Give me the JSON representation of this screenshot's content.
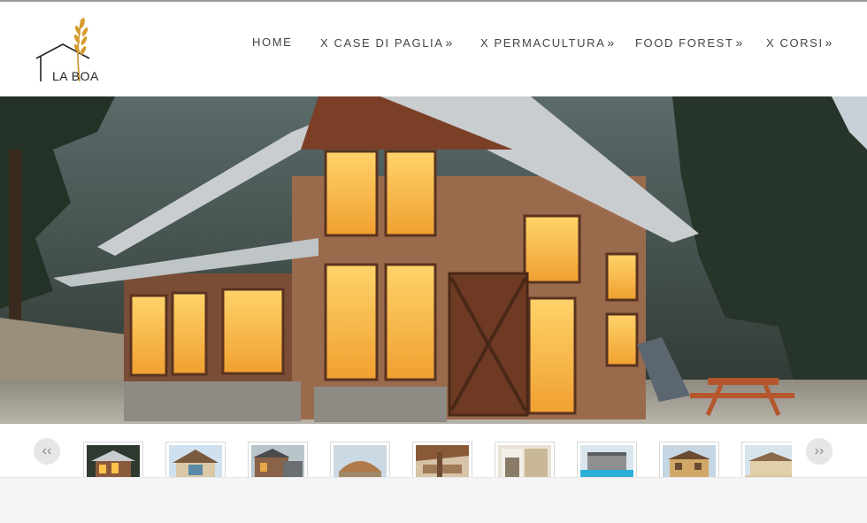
{
  "site": {
    "logo_text": "LA BOA"
  },
  "nav": {
    "items": [
      {
        "label": "HOME",
        "arrow": ""
      },
      {
        "label": "X CASE DI PAGLIA",
        "arrow": "»"
      },
      {
        "label": "X PERMACULTURA",
        "arrow": "»"
      },
      {
        "label": "FOOD FOREST",
        "arrow": "»"
      },
      {
        "label": "X CORSI",
        "arrow": "»"
      }
    ]
  },
  "slider": {
    "prev_label": "‹‹",
    "next_label": "››",
    "thumbnails": [
      "thumb-1",
      "thumb-2",
      "thumb-3",
      "thumb-4",
      "thumb-5",
      "thumb-6",
      "thumb-7",
      "thumb-8",
      "thumb-9"
    ]
  },
  "colors": {
    "accent": "#c8902a",
    "nav_text": "#444444",
    "header_bg": "#ffffff"
  }
}
